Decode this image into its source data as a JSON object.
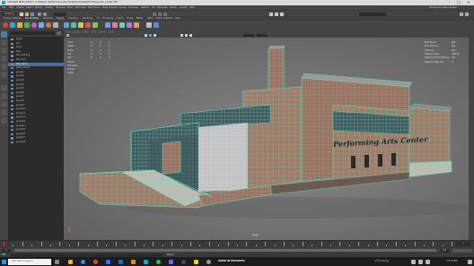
{
  "window": {
    "title": "Autodesk MAYA 2018.3: C:/Users/.../Performing Arts Center/scenes/performing_arts_center.mb*"
  },
  "menus": [
    "File",
    "Edit",
    "Create",
    "Select",
    "Modify",
    "Display",
    "Windows",
    "Mesh",
    "Edit Mesh",
    "Mesh Tools",
    "Mesh Display",
    "Curves",
    "Surfaces",
    "Deform",
    "UV",
    "Generate",
    "Cache",
    "Arnold",
    "Help"
  ],
  "statusline": {
    "menuset": "Modeling",
    "workspace": "Workspace: Maya Classic"
  },
  "shelf_tabs": [
    "Curves / Surfaces",
    "Poly Modeling",
    "Sculpting",
    "Rigging",
    "Animation",
    "Rendering",
    "FX",
    "FX Caching",
    "Custom",
    "Arnold",
    "Bifrost",
    "MASH",
    "Motion Graphics",
    "XGen"
  ],
  "outliner": {
    "items": [
      "persp",
      "top",
      "front",
      "side",
      "PAC_building",
      "PAC_roof",
      "PAC_stairs",
      "glass_panels",
      "group1",
      "group2",
      "group3",
      "group4",
      "group5",
      "group6",
      "group7",
      "group8",
      "group9",
      "group10",
      "group11",
      "group12",
      "group13",
      "group14",
      "group15",
      "group16",
      "group17",
      "group18"
    ],
    "selected_index": 6
  },
  "viewport": {
    "sign_text": "Performing Arts Center",
    "hud_left": [
      {
        "label": "Verts:",
        "v1": "0",
        "v2": "0",
        "v3": "0"
      },
      {
        "label": "Edges:",
        "v1": "0",
        "v2": "0",
        "v3": "0"
      },
      {
        "label": "Faces:",
        "v1": "0",
        "v2": "0",
        "v3": "0"
      },
      {
        "label": "Tris:",
        "v1": "0",
        "v2": "0",
        "v3": "0"
      },
      {
        "label": "UVs:",
        "v1": "0",
        "v2": "0",
        "v3": "0"
      },
      {
        "label": "Object:",
        "v1": "",
        "v2": "",
        "v3": ""
      },
      {
        "label": "Translate:",
        "v1": "",
        "v2": "",
        "v3": ""
      },
      {
        "label": "Rotate:",
        "v1": "",
        "v2": "",
        "v3": ""
      },
      {
        "label": "Scale:",
        "v1": "",
        "v2": "",
        "v3": ""
      }
    ],
    "hud_right": [
      {
        "label": "Backfaces:",
        "value": "N/A"
      },
      {
        "label": "Smoothness:",
        "value": "N/A"
      },
      {
        "label": "Instance:",
        "value": "N/A"
      },
      {
        "label": "Display Layer:",
        "value": "default"
      },
      {
        "label": "Distance From Camera:",
        "value": "N/A"
      },
      {
        "label": "Selected Objects:",
        "value": "0"
      }
    ]
  },
  "timeslider": {
    "start": "1",
    "end": "120",
    "current": "1"
  },
  "command_line": {
    "lang": "MEL",
    "label": "Result:"
  },
  "taskbar": {
    "search_placeholder": "Type here to search",
    "status": "WORK IN PROGRESS",
    "weather": "17°C Cloudy",
    "clock": "12:31 PM"
  }
}
